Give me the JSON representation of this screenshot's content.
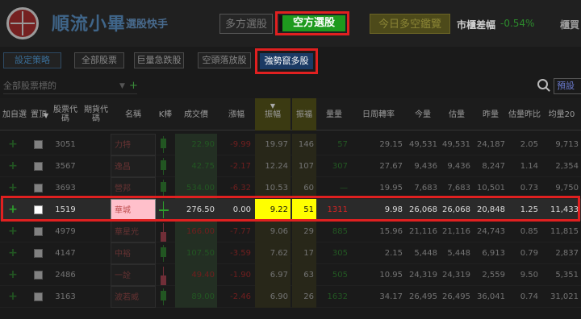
{
  "app": {
    "logo_text": "順流小畢",
    "logo_sub": "選股快手"
  },
  "header": {
    "multi_button": "多方選股",
    "short_button": "空方選股",
    "today_button": "今日多空鑑覽",
    "market_diff_label": "市櫃差幅",
    "market_diff_value": "-0.54%",
    "extra_label": "櫃買"
  },
  "tabs": [
    {
      "label": "設定策略"
    },
    {
      "label": "全部股票"
    },
    {
      "label": "巨量急跌股"
    },
    {
      "label": "空頭落放股"
    },
    {
      "label": "強勢竄多股"
    }
  ],
  "filter": {
    "placeholder": "全部股票標的",
    "preset_label": "預設"
  },
  "columns": [
    {
      "label": "加自選"
    },
    {
      "label": "置頂"
    },
    {
      "label": "股票代碼"
    },
    {
      "label": "期貨代碼"
    },
    {
      "label": "名稱"
    },
    {
      "label": "K棒"
    },
    {
      "label": "成交價"
    },
    {
      "label": "漲幅"
    },
    {
      "label": "振幅"
    },
    {
      "label": "振福"
    },
    {
      "label": "量量"
    },
    {
      "label": "日周轉率"
    },
    {
      "label": "今量"
    },
    {
      "label": "估量"
    },
    {
      "label": "昨量"
    },
    {
      "label": "估量昨比"
    },
    {
      "label": "均量20"
    }
  ],
  "rows": [
    {
      "add": "+",
      "code": "3051",
      "name": "力特",
      "price": "22.90",
      "chg": "-9.99",
      "amp": "19.97",
      "amp2": "146",
      "vol": "57",
      "turn": "29.15",
      "today": "49,531",
      "est": "49,531",
      "yest": "24,187",
      "ratio": "2.05",
      "avg20": "9,713",
      "dir": "up"
    },
    {
      "add": "+",
      "code": "3567",
      "name": "逸昌",
      "price": "42.75",
      "chg": "-2.17",
      "amp": "12.24",
      "amp2": "107",
      "vol": "307",
      "turn": "27.67",
      "today": "9,436",
      "est": "9,436",
      "yest": "8,247",
      "ratio": "1.14",
      "avg20": "2,354",
      "dir": "up"
    },
    {
      "add": "+",
      "code": "3693",
      "name": "營邦",
      "price": "534.00",
      "chg": "-6.32",
      "amp": "10.53",
      "amp2": "60",
      "vol": "—",
      "turn": "19.95",
      "today": "7,683",
      "est": "7,683",
      "yest": "10,501",
      "ratio": "0.73",
      "avg20": "9,750",
      "dir": "up"
    },
    {
      "add": "+",
      "code": "1519",
      "name": "華城",
      "price": "276.50",
      "chg": "0.00",
      "amp": "9.22",
      "amp2": "51",
      "vol": "1311",
      "turn": "9.98",
      "today": "26,068",
      "est": "26,068",
      "yest": "20,848",
      "ratio": "1.25",
      "avg20": "11,433",
      "dir": "flat"
    },
    {
      "add": "+",
      "code": "4979",
      "name": "華星光",
      "price": "166.00",
      "chg": "-7.77",
      "amp": "9.06",
      "amp2": "29",
      "vol": "885",
      "turn": "15.96",
      "today": "21,116",
      "est": "21,116",
      "yest": "24,743",
      "ratio": "0.85",
      "avg20": "11,815",
      "dir": "down"
    },
    {
      "add": "+",
      "code": "4147",
      "name": "中裕",
      "price": "107.50",
      "chg": "-3.59",
      "amp": "7.62",
      "amp2": "17",
      "vol": "305",
      "turn": "2.15",
      "today": "5,448",
      "est": "5,448",
      "yest": "6,913",
      "ratio": "0.79",
      "avg20": "2,837",
      "dir": "up"
    },
    {
      "add": "+",
      "code": "2486",
      "name": "一詮",
      "price": "49.40",
      "chg": "-1.90",
      "amp": "6.97",
      "amp2": "63",
      "vol": "505",
      "turn": "10.95",
      "today": "24,319",
      "est": "24,319",
      "yest": "2,559",
      "ratio": "9.50",
      "avg20": "5,351",
      "dir": "down"
    },
    {
      "add": "+",
      "code": "3163",
      "name": "波若威",
      "price": "89.00",
      "chg": "-2.46",
      "amp": "6.90",
      "amp2": "26",
      "vol": "1632",
      "turn": "34.17",
      "today": "26,495",
      "est": "26,495",
      "yest": "36,041",
      "ratio": "0.74",
      "avg20": "31,021",
      "dir": "up"
    }
  ]
}
